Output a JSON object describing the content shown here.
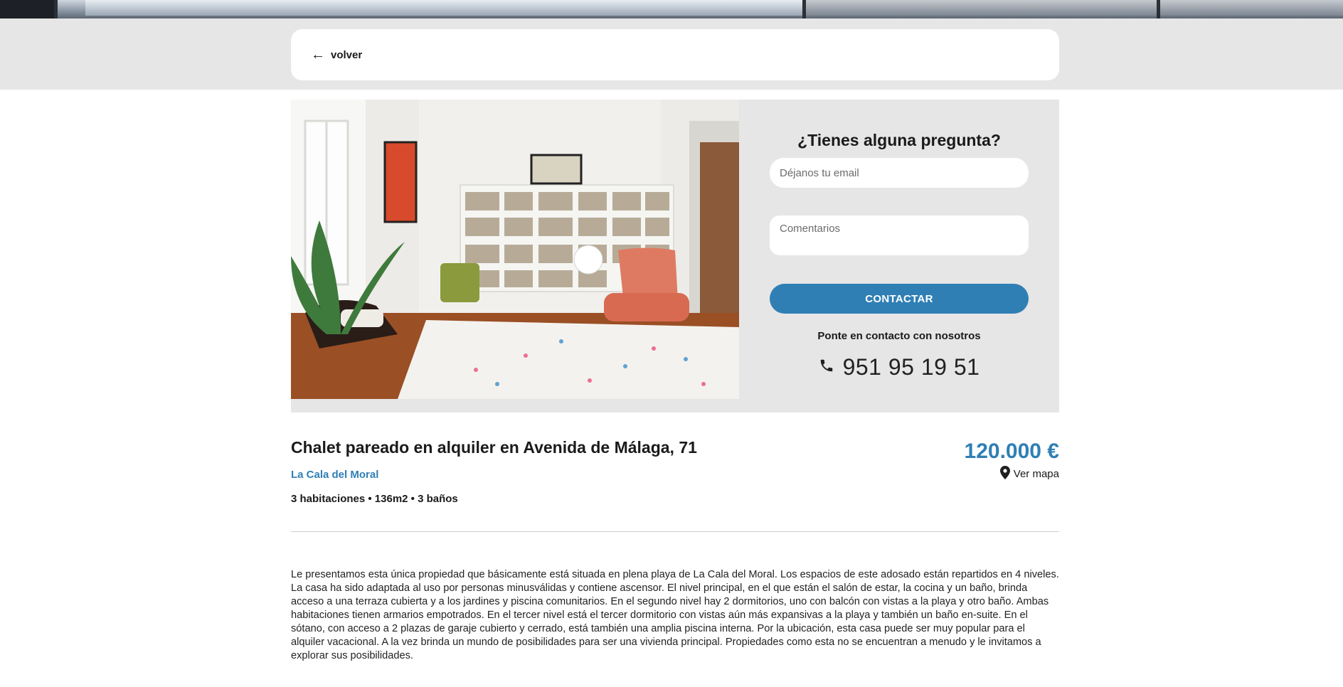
{
  "nav": {
    "back_label": "volver"
  },
  "contact": {
    "title": "¿Tienes alguna pregunta?",
    "email_placeholder": "Déjanos tu email",
    "comments_placeholder": "Comentarios",
    "button_label": "CONTACTAR",
    "note": "Ponte en contacto con nosotros",
    "phone": "951 95 19 51",
    "phone_icon": "phone-icon"
  },
  "listing": {
    "title": "Chalet pareado en alquiler en Avenida de Málaga, 71",
    "zone": "La Cala del Moral",
    "specs": "3 habitaciones • 136m2 • 3 baños",
    "price": "120.000 €",
    "map_label": "Ver mapa",
    "map_icon": "map-pin-icon",
    "description": "Le presentamos esta única propiedad que básicamente está situada en plena playa de La Cala del Moral. Los espacios de este adosado están repartidos en 4 niveles. La casa ha sido adaptada al uso por personas minusválidas y contiene ascensor. El nivel principal, en el que están el salón de estar, la cocina y un baño, brinda acceso a una terraza cubierta y a los jardines y piscina comunitarios. En el segundo nivel hay 2 dormitorios, uno con balcón con vistas a la playa y otro baño. Ambas habitaciones tienen armarios empotrados. En el tercer nivel está el tercer dormitorio con vistas aún más expansivas a la playa y también un baño en-suite. En el sótano, con acceso a 2 plazas de garaje cubierto y cerrado, está también una amplia piscina interna. Por la ubicación, esta casa puede ser muy popular para el alquiler vacacional. A la vez brinda un mundo de posibilidades para ser una vivienda principal. Propiedades como esta no se encuentran a menudo y le invitamos a explorar sus posibilidades."
  },
  "colors": {
    "accent": "#2f7fb5",
    "panel": "#e6e6e6"
  }
}
